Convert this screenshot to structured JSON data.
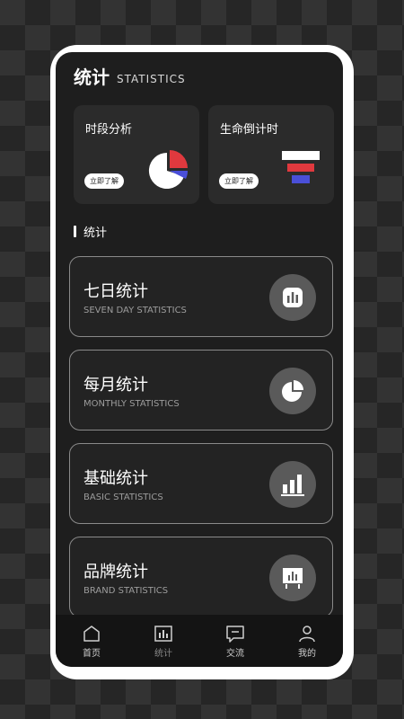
{
  "header": {
    "title": "统计",
    "subtitle": "STATISTICS"
  },
  "cards": [
    {
      "title": "时段分析",
      "button": "立即了解",
      "icon": "pie-chart-icon"
    },
    {
      "title": "生命倒计时",
      "button": "立即了解",
      "icon": "bars-icon"
    }
  ],
  "section": {
    "label": "统计"
  },
  "items": [
    {
      "title": "七日统计",
      "subtitle": "SEVEN DAY STATISTICS",
      "icon": "bar-chart-icon"
    },
    {
      "title": "每月统计",
      "subtitle": "MONTHLY STATISTICS",
      "icon": "pie-icon"
    },
    {
      "title": "基础统计",
      "subtitle": "BASIC STATISTICS",
      "icon": "column-chart-icon"
    },
    {
      "title": "品牌统计",
      "subtitle": "BRAND STATISTICS",
      "icon": "board-chart-icon"
    }
  ],
  "tabs": [
    {
      "label": "首页",
      "icon": "home-icon"
    },
    {
      "label": "统计",
      "icon": "chart-icon",
      "active": true
    },
    {
      "label": "交流",
      "icon": "message-icon"
    },
    {
      "label": "我的",
      "icon": "user-icon"
    }
  ],
  "colors": {
    "accent_red": "#e0393e",
    "accent_blue": "#4a4fd8"
  }
}
